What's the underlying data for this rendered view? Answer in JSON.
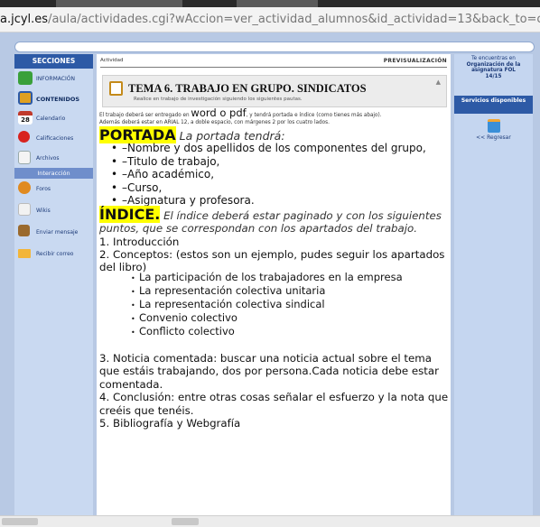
{
  "browser": {
    "url_host": "a.jcyl.es",
    "url_path": "/aula/actividades.cgi?wAccion=ver_actividad_alumnos&id_actividad=13&back_to=contenido&"
  },
  "sidebar": {
    "header": "SECCIONES",
    "items": [
      {
        "label": "INFORMACIÓN",
        "icon": "info-icon"
      },
      {
        "label": "CONTENIDOS",
        "icon": "contents-icon"
      },
      {
        "label": "Calendario",
        "icon": "calendar-icon",
        "badge": "28"
      },
      {
        "label": "Calificaciones",
        "icon": "grades-icon"
      },
      {
        "label": "Archivos",
        "icon": "files-icon"
      }
    ],
    "interaction_header": "Interacción",
    "interaction_items": [
      {
        "label": "Foros",
        "icon": "forum-icon"
      },
      {
        "label": "Wikis",
        "icon": "wiki-icon"
      },
      {
        "label": "Enviar mensaje",
        "icon": "send-message-icon"
      },
      {
        "label": "Recibir correo",
        "icon": "mail-icon"
      }
    ]
  },
  "main": {
    "breadcrumb": "Actividad",
    "preview_label": "PREVISUALIZACIÓN",
    "title": "TEMA 6. TRABAJO EN GRUPO. SINDICATOS",
    "subtitle": "Realice en trabajo de investigación siguiendo los siguientes pautas.",
    "intro_1": "El trabajo deberá ser entregado en ",
    "intro_big": "word o pdf",
    "intro_2": ", y tendrá portada e índice (como tienes más abajo).",
    "intro_line2": "Además deberá estar en ARIAL 12, a doble espacio, con márgenes 2 por los cuatro lados.",
    "portada_label": "PORTADA",
    "portada_text": " La portada tendrá:",
    "portada_items": [
      "–Nombre y dos apellidos de los componentes del grupo,",
      "–Titulo de trabajo,",
      "–Año académico,",
      "–Curso,",
      "–Asignatura y profesora."
    ],
    "indice_label": "ÍNDICE.",
    "indice_text": " El índice deberá estar paginado y con los siguientes puntos, que se correspondan con los apartados del trabajo.",
    "indice_line1": "1. Introducción",
    "indice_line2": "2. Conceptos: (estos son un ejemplo, pudes seguir los apartados del libro)",
    "concepts": [
      "La participación de los trabajadores en la empresa",
      "La representación colectiva unitaria",
      "La representación colectiva sindical",
      "Convenio colectivo",
      "Conflicto colectivo"
    ],
    "point3": "3. Noticia comentada: buscar una noticia actual sobre el tema que estáis trabajando, dos por persona.Cada noticia debe estar comentada.",
    "point4": "4. Conclusión: entre otras cosas señalar el esfuerzo y la nota que creéis que tenéis.",
    "point5": "5. Bibliografía y Webgrafía"
  },
  "right": {
    "location_1": "Te encuentras en",
    "location_2": "Organización de la asignatura FOL",
    "location_3": "14/15",
    "services_header": "Servicios disponibles",
    "back_label": "<< Regresar"
  }
}
